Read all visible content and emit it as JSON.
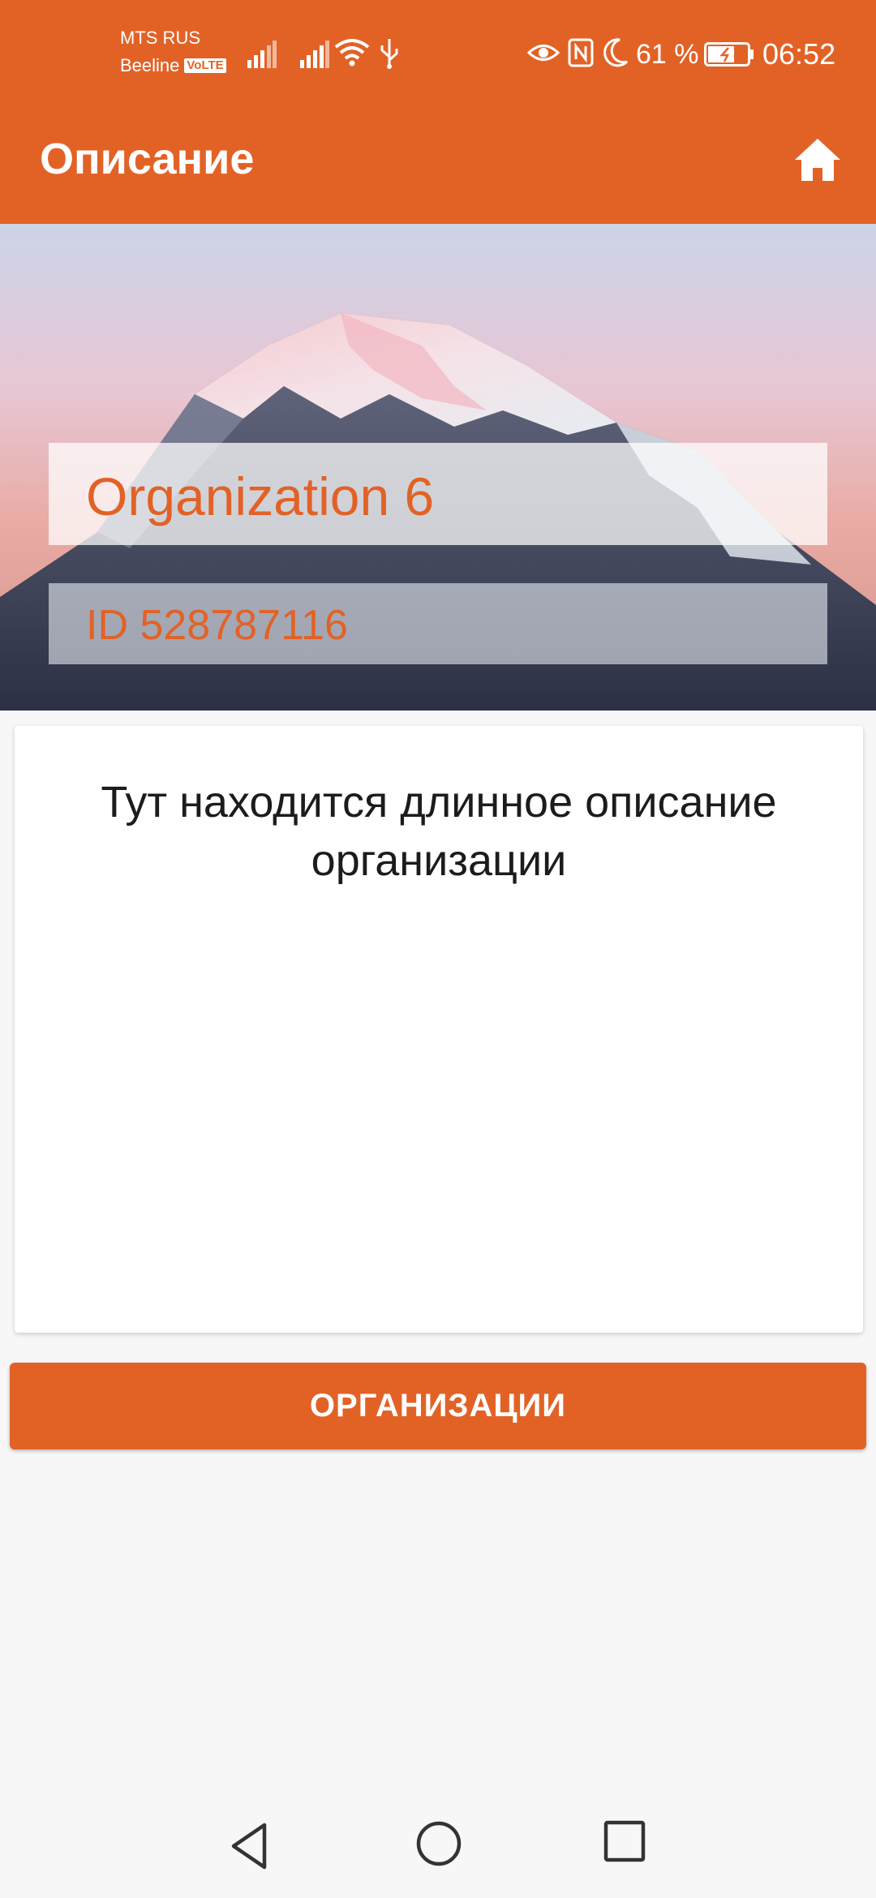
{
  "status_bar": {
    "carrier_1": "MTS RUS",
    "carrier_2": "Beeline",
    "volte_badge": "VoLTE",
    "battery_percent": "61 %",
    "time": "06:52",
    "icons": [
      "signal-icon",
      "signal-icon",
      "wifi-icon",
      "usb-icon",
      "eye-icon",
      "nfc-icon",
      "moon-icon",
      "battery-icon"
    ]
  },
  "app_bar": {
    "title": "Описание",
    "home_icon": "home-icon"
  },
  "hero": {
    "organization_name": "Organization 6",
    "organization_id": "ID 528787116"
  },
  "description": {
    "text": "Тут находится длинное описание организации"
  },
  "button": {
    "label": "ОРГАНИЗАЦИИ"
  },
  "nav_bar": {
    "icons": [
      "back-icon",
      "home-circle-icon",
      "recents-icon"
    ]
  },
  "colors": {
    "accent": "#e26226",
    "background": "#f7f7f7",
    "card": "#ffffff"
  }
}
